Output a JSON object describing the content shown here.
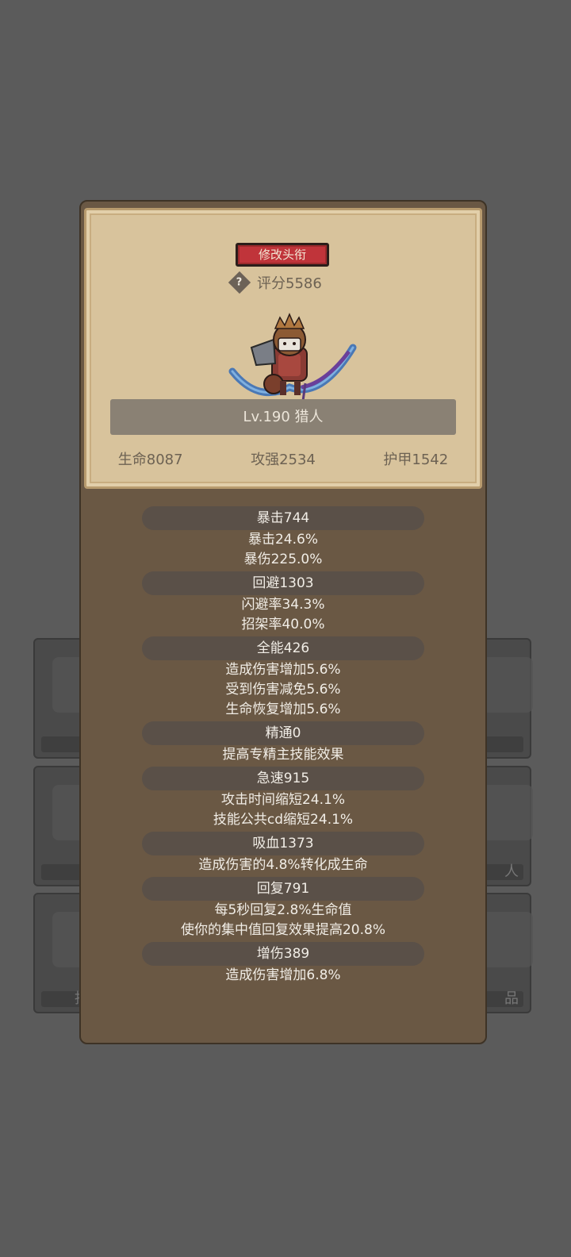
{
  "panel": {
    "title_button": "修改头衔",
    "score": "评分5586",
    "level_label": "Lv.190 猎人",
    "stats": {
      "hp": "生命8087",
      "attack": "攻强2534",
      "armor": "护甲1542"
    }
  },
  "sections": [
    {
      "header": "暴击744",
      "lines": [
        "暴击24.6%",
        "暴伤225.0%"
      ]
    },
    {
      "header": "回避1303",
      "lines": [
        "闪避率34.3%",
        "招架率40.0%"
      ]
    },
    {
      "header": "全能426",
      "lines": [
        "造成伤害增加5.6%",
        "受到伤害减免5.6%",
        "生命恢复增加5.6%"
      ]
    },
    {
      "header": "精通0",
      "lines": [
        "提高专精主技能效果"
      ]
    },
    {
      "header": "急速915",
      "lines": [
        "攻击时间缩短24.1%",
        "技能公共cd缩短24.1%"
      ]
    },
    {
      "header": "吸血1373",
      "lines": [
        "造成伤害的4.8%转化成生命"
      ]
    },
    {
      "header": "回复791",
      "lines": [
        "每5秒回复2.8%生命值",
        "使你的集中值回复效果提高20.8%"
      ]
    },
    {
      "header": "增伤389",
      "lines": [
        "造成伤害增加6.8%"
      ]
    }
  ],
  "background_cards": {
    "right_middle_label": "人",
    "left_bottom_label": "指",
    "right_bottom_label": "品"
  },
  "colors": {
    "title_button": "#c0343a",
    "parchment": "#d8c39c",
    "panel": "#6a5844"
  }
}
